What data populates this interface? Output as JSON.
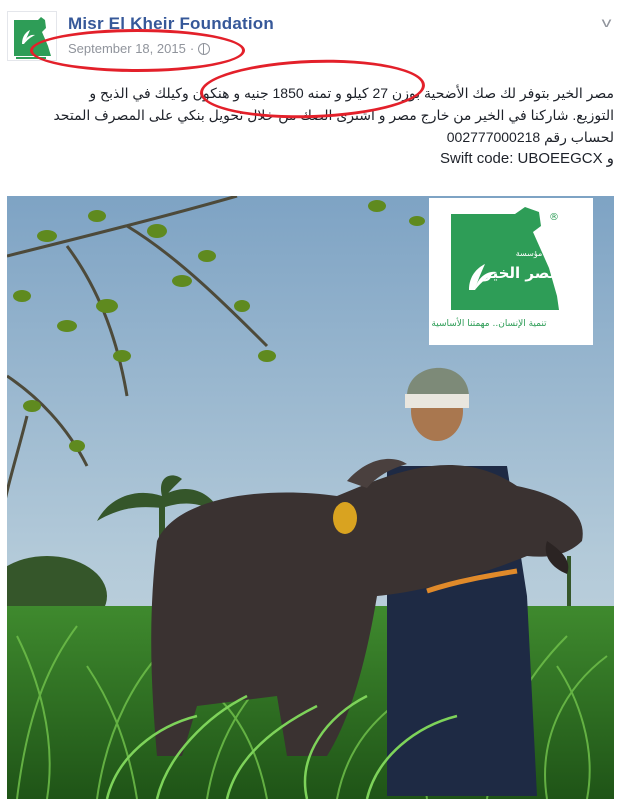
{
  "page": {
    "name": "Misr El Kheir Foundation",
    "date": "September 18, 2015",
    "separator": "·"
  },
  "post": {
    "line1": "مصر الخير بتوفر لك صك الأضحية بوزن 27 كيلو و تمنه 1850 جنيه و هنكون وكيلك في الذبح و",
    "line2": "التوزيع. شاركنا في الخير من خارج مصر و اشترى الصك من خلال تحويل بنكي على المصرف المتحد",
    "line3": "لحساب رقم 002777000218",
    "line4": "و Swift code: UBOEEGCX"
  },
  "logo": {
    "arabic_name": "مصر الخير",
    "prefix": "مؤسسة",
    "tagline": "تنمية الإنسان.. مهمتنا الأساسية",
    "registered": "®"
  },
  "colors": {
    "brand_green": "#2e9d57",
    "link_blue": "#365899",
    "meta_gray": "#90949c",
    "annotation_red": "#e3202a"
  },
  "icons": {
    "privacy": "globe-icon",
    "menu": "chevron-down-icon"
  }
}
